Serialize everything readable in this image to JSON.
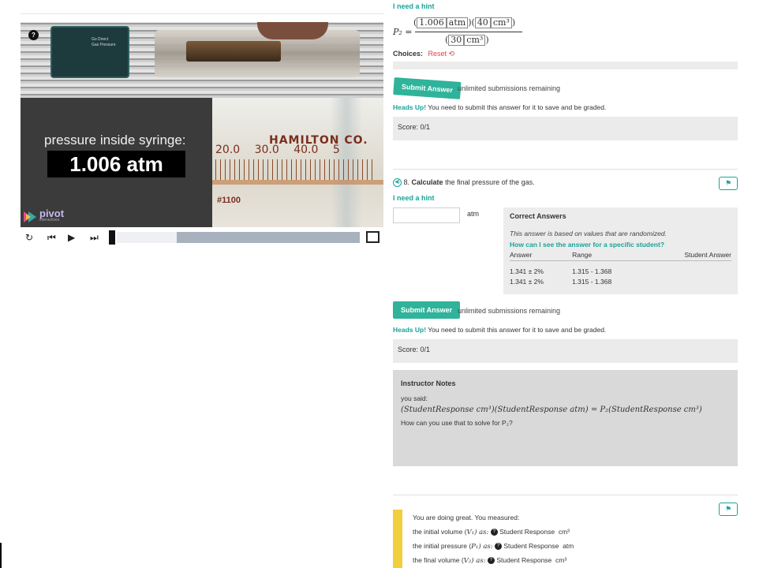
{
  "video": {
    "pressure_label": "pressure inside syringe:",
    "pressure_value": "1.006 atm",
    "help_icon": "?",
    "sensor_text_1": "Go Direct",
    "sensor_text_2": "Gas Pressure",
    "zoom_brand": "HAMILTON CO.",
    "zoom_ticks": "20.0 30.0 40.0 5",
    "zoom_serial": "#1100",
    "logo_text": "pivot",
    "logo_sub": "interactives"
  },
  "q7": {
    "hint": "I need a hint",
    "formula": {
      "lhs": "P₂ =",
      "num_v1": "1.006",
      "num_u1": "atm",
      "num_v2": "40",
      "num_u2": "cm³",
      "den_v": "30",
      "den_u": "cm³"
    },
    "choices_label": "Choices:",
    "reset_label": "Reset ⟲",
    "submit_label": "Submit Answer",
    "remaining": "unlimited submissions remaining",
    "headsup_label": "Heads Up!",
    "headsup_text": " You need to submit this answer for it to save and be graded.",
    "score": "Score: 0/1"
  },
  "q8": {
    "speaker_icon": "◀)",
    "number": "8.",
    "prompt_bold": "Calculate",
    "prompt_rest": " the final pressure of the gas.",
    "hint": "I need a hint",
    "answer_value": "",
    "unit": "atm",
    "flag_icon": "⚑",
    "correct_answers": {
      "title": "Correct Answers",
      "note": "This answer is based on values that are randomized.",
      "how_link": "How can I see the answer for a specific student?",
      "columns": [
        "Answer",
        "Range",
        "Student Answer"
      ],
      "rows": [
        [
          "1.341 ± 2%",
          "1.315 - 1.368",
          ""
        ],
        [
          "1.341 ± 2%",
          "1.315 - 1.368",
          ""
        ]
      ]
    },
    "submit_label": "Submit Answer",
    "remaining": "unlimited submissions remaining",
    "headsup_label": "Heads Up!",
    "headsup_text": " You need to submit this answer for it to save and be graded.",
    "score": "Score: 0/1"
  },
  "instructor_notes": {
    "title": "Instructor Notes",
    "you_said": "you said:",
    "equation": "(StudentResponse cm³)(StudentResponse atm) = P₂(StudentResponse cm³)",
    "question": "How can you use that to solve for P₂?"
  },
  "feedback": {
    "flag_icon": "⚑",
    "intro": "You are doing great. You measured:",
    "line1_pre": "the initial volume (",
    "line1_var": "V₁",
    "line1_mid": ") as:",
    "line1_resp": "Student Response",
    "line1_unit": "cm³",
    "line2_pre": "the initial pressure (",
    "line2_var": "P₁",
    "line2_mid": ") as:",
    "line2_resp": "Student Response",
    "line2_unit": "atm",
    "line3_pre": "the final volume (",
    "line3_var": "V₂",
    "line3_mid": ") as:",
    "line3_resp": "Student Response",
    "line3_unit": "cm³",
    "qmark": "?"
  },
  "colors": {
    "accent": "#2fb39a",
    "link": "#1aa39a",
    "reset": "#dd4444",
    "notes_bg": "#d9d9d9",
    "score_bg": "#ebebeb",
    "stripe": "#f2cf3c"
  },
  "controls": {
    "replay_icon": "replay-icon",
    "prev_icon": "skip-back-icon",
    "play_icon": "play-icon",
    "next_icon": "skip-forward-icon",
    "fullscreen_icon": "fullscreen-icon"
  }
}
